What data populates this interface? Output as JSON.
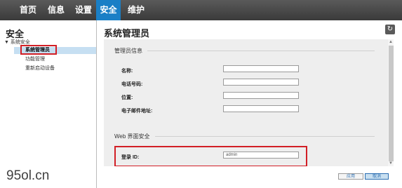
{
  "nav": {
    "tabs": [
      {
        "label": "首页"
      },
      {
        "label": "信息"
      },
      {
        "label": "设置"
      },
      {
        "label": "安全"
      },
      {
        "label": "维护"
      }
    ],
    "active_color": "#1a7fc6"
  },
  "sidebar": {
    "title": "安全",
    "tree_head": "▼ 系统安全",
    "items": [
      {
        "label": "系统管理员"
      },
      {
        "label": "功能管理"
      },
      {
        "label": "重新启动设备"
      }
    ]
  },
  "main": {
    "title": "系统管理员",
    "refresh_icon": "↻",
    "admin_section": {
      "title": "管理员信息",
      "fields": [
        {
          "label": "名称:",
          "value": ""
        },
        {
          "label": "电话号码:",
          "value": ""
        },
        {
          "label": "位置:",
          "value": ""
        },
        {
          "label": "电子邮件地址:",
          "value": ""
        }
      ]
    },
    "web_section": {
      "title": "Web 界面安全",
      "login_label": "登录 ID:",
      "login_value": "admin"
    }
  },
  "buttons": {
    "apply": "应用",
    "cancel": "取消"
  },
  "watermark": "95ol.cn",
  "colors": {
    "highlight_box": "#d21f26",
    "selected_item": "#c6dff2"
  }
}
